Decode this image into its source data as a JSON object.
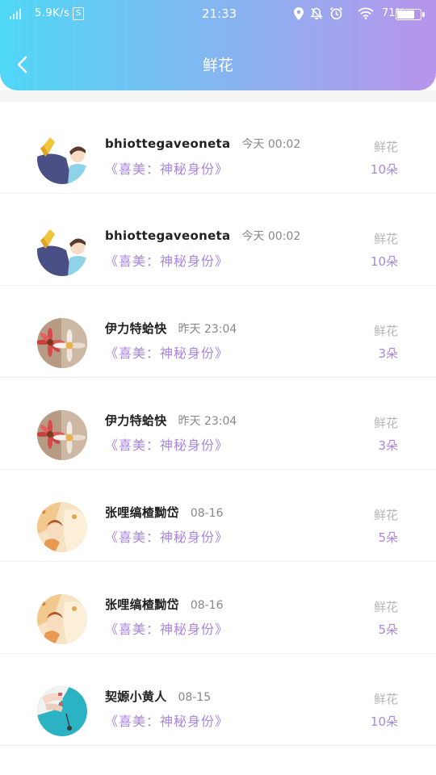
{
  "status_bar": {
    "speed": "5.9K/s",
    "s_icon_letter": "S",
    "time": "21:33",
    "battery_pct": "71%",
    "battery_level": 0.71
  },
  "header": {
    "title": "鲜花"
  },
  "records": [
    {
      "name": "bhiottegaveoneta",
      "time": "今天 00:02",
      "gift": "《喜美：神秘身份》",
      "flower_label": "鲜花",
      "count": "10朵",
      "avatar": "cartoon-man-avatar"
    },
    {
      "name": "bhiottegaveoneta",
      "time": "今天 00:02",
      "gift": "《喜美：神秘身份》",
      "flower_label": "鲜花",
      "count": "10朵",
      "avatar": "cartoon-man-avatar"
    },
    {
      "name": "伊力特蛤快",
      "time": "昨天 23:04",
      "gift": "《喜美：神秘身份》",
      "flower_label": "鲜花",
      "count": "3朵",
      "avatar": "flower-photo-avatar"
    },
    {
      "name": "伊力特蛤快",
      "time": "昨天 23:04",
      "gift": "《喜美：神秘身份》",
      "flower_label": "鲜花",
      "count": "3朵",
      "avatar": "flower-photo-avatar"
    },
    {
      "name": "张哩缟楂黝岱",
      "time": "08-16",
      "gift": "《喜美：神秘身份》",
      "flower_label": "鲜花",
      "count": "5朵",
      "avatar": "anime-art-avatar"
    },
    {
      "name": "张哩缟楂黝岱",
      "time": "08-16",
      "gift": "《喜美：神秘身份》",
      "flower_label": "鲜花",
      "count": "5朵",
      "avatar": "anime-art-avatar"
    },
    {
      "name": "契嫄小黄人",
      "time": "08-15",
      "gift": "《喜美：神秘身份》",
      "flower_label": "鲜花",
      "count": "10朵",
      "avatar": "hands-photo-avatar"
    }
  ],
  "colors": {
    "accent": "#a887e0",
    "header_start": "#4fd7f6",
    "header_end": "#b894ec"
  }
}
